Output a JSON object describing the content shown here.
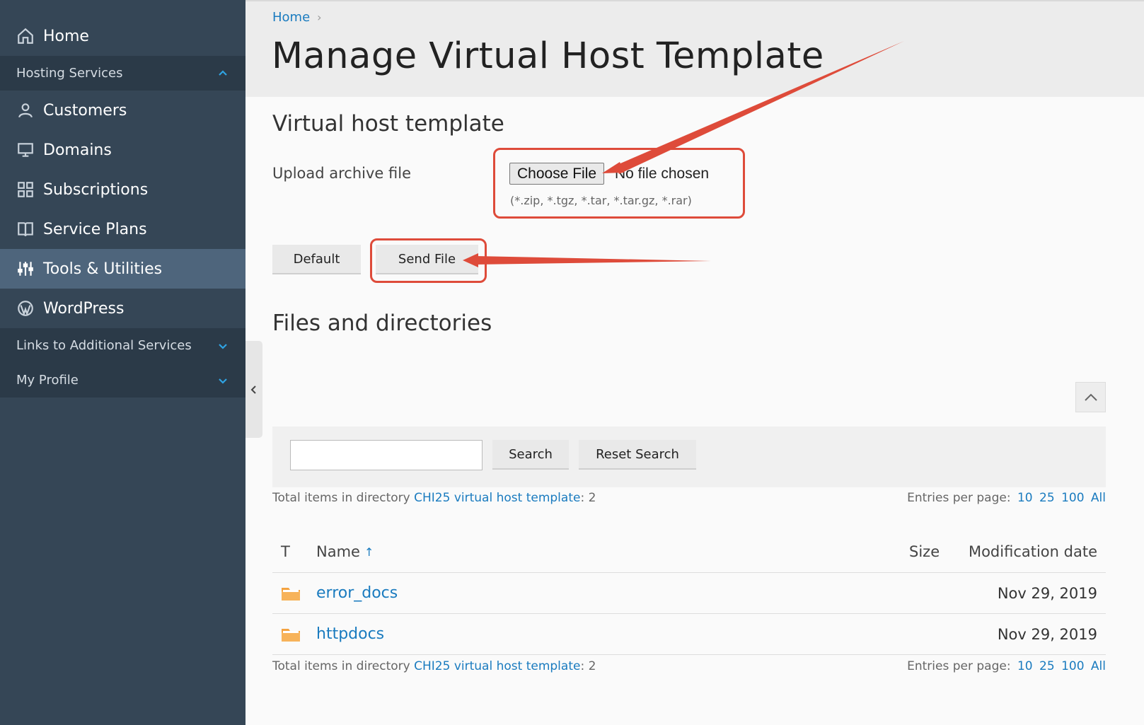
{
  "sidebar": {
    "items": [
      {
        "label": "Home",
        "icon": "home-icon"
      },
      {
        "label": "Customers",
        "icon": "user-icon"
      },
      {
        "label": "Domains",
        "icon": "monitor-icon"
      },
      {
        "label": "Subscriptions",
        "icon": "grid-icon"
      },
      {
        "label": "Service Plans",
        "icon": "book-icon"
      },
      {
        "label": "Tools & Utilities",
        "icon": "sliders-icon",
        "active": true
      },
      {
        "label": "WordPress",
        "icon": "wordpress-icon"
      }
    ],
    "groups": [
      {
        "label": "Hosting Services",
        "state": "expanded"
      },
      {
        "label": "Links to Additional Services",
        "state": "collapsed"
      },
      {
        "label": "My Profile",
        "state": "collapsed"
      }
    ]
  },
  "header": {
    "breadcrumb": [
      "Home"
    ],
    "title": "Manage Virtual Host Template"
  },
  "template_section": {
    "title": "Virtual host template",
    "upload_label": "Upload archive file",
    "choose_file_label": "Choose File",
    "no_file_text": "No file chosen",
    "file_types_hint": "(*.zip, *.tgz, *.tar, *.tar.gz, *.rar)",
    "default_button": "Default",
    "send_button": "Send File"
  },
  "files_section": {
    "title": "Files and directories",
    "search_button": "Search",
    "reset_search_button": "Reset Search",
    "search_value": "",
    "total_prefix": "Total items in directory",
    "directory_link": "CHI25 virtual host template",
    "total_suffix": ": 2",
    "entries_label": "Entries per page:",
    "entries_options": [
      "10",
      "25",
      "100",
      "All"
    ],
    "columns": {
      "type": "T",
      "name": "Name",
      "size": "Size",
      "date": "Modification date"
    },
    "sort_indicator": "↑",
    "rows": [
      {
        "name": "error_docs",
        "size": "",
        "date": "Nov 29, 2019"
      },
      {
        "name": "httpdocs",
        "size": "",
        "date": "Nov 29, 2019"
      }
    ]
  },
  "colors": {
    "sidebar_bg": "#354656",
    "sidebar_group_bg": "#2b3a48",
    "active_item_bg": "#4e657c",
    "link": "#1a7bbf",
    "annotation_red": "#de4b3a",
    "folder": "#f4a340"
  }
}
